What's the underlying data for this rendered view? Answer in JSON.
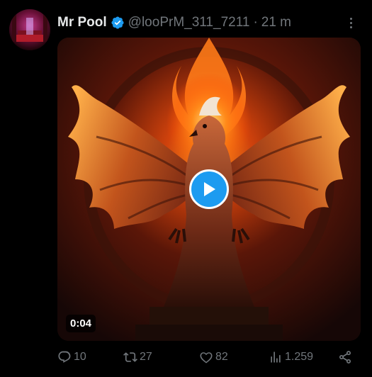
{
  "post": {
    "display_name": "Mr Pool",
    "handle": "@looPrM_311_7211",
    "separator": "·",
    "time": "21 m",
    "verified": true
  },
  "media": {
    "type": "video",
    "duration": "0:04",
    "description_icon": "play-icon"
  },
  "actions": {
    "replies": "10",
    "reposts": "27",
    "likes": "82",
    "views": "1.259"
  },
  "colors": {
    "background": "#000000",
    "name": "#e7e9ea",
    "secondary": "#71767b",
    "accent": "#1d9bf0"
  },
  "icons": {
    "verified": "verified-badge-icon",
    "more": "more-options-icon",
    "reply": "reply-icon",
    "repost": "repost-icon",
    "like": "heart-icon",
    "views": "views-icon",
    "share": "share-icon"
  }
}
